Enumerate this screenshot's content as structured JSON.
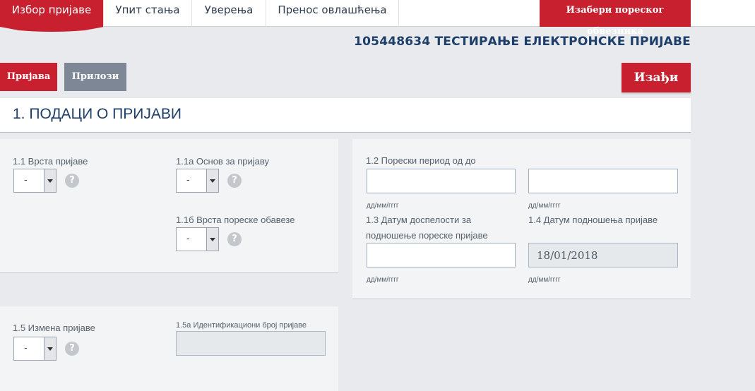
{
  "nav": {
    "tabs": [
      "Избор пријаве",
      "Упит стања",
      "Уверења",
      "Пренос овлашћења"
    ],
    "taxpayer_button": "Изабери пореског обвезника"
  },
  "page_title": "105448634 ТЕСТИРАЊЕ ЕЛЕКТРОНСКЕ ПРИЈАВЕ",
  "actions": {
    "prijava": "Пријава",
    "prilozi": "Прилози",
    "exit": "Изађи"
  },
  "section": {
    "title": "1. ПОДАЦИ О ПРИЈАВИ"
  },
  "form": {
    "f1_1": {
      "label": "1.1 Врста пријаве",
      "value": "-"
    },
    "f1_1a": {
      "label": "1.1а Основ за пријаву",
      "value": "-"
    },
    "f1_1b": {
      "label": "1.1б Врста пореске обавезе",
      "value": "-"
    },
    "f1_2": {
      "label": "1.2 Порески период од до",
      "from": "",
      "to": "",
      "hint": "дд/мм/гггг"
    },
    "f1_3": {
      "label_line1": "1.3 Датум доспелости за",
      "label_line2": "подношење пореске пријаве",
      "value": "",
      "hint": "дд/мм/гггг"
    },
    "f1_4": {
      "label": "1.4 Датум подношења пријаве",
      "value": "18/01/2018",
      "hint": "дд/мм/гггг"
    },
    "f1_5": {
      "label": "1.5 Измена пријаве",
      "value": "-"
    },
    "f1_5a": {
      "label": "1.5а Идентификациони број пријаве",
      "value": ""
    }
  },
  "help_glyph": "?",
  "icons": {
    "help": "help-icon",
    "dropdown": "chevron-down-icon"
  },
  "colors": {
    "accent": "#c8202f",
    "title": "#1f3f6b",
    "secondary_button": "#7d8796"
  }
}
